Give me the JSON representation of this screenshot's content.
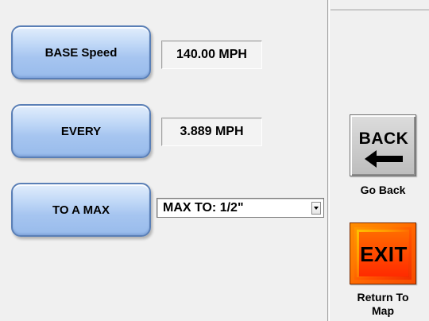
{
  "controls": {
    "base_speed": {
      "label": "BASE Speed",
      "value": "140.00 MPH"
    },
    "every": {
      "label": "EVERY",
      "value": "3.889 MPH"
    },
    "to_a_max": {
      "label": "TO A MAX",
      "selected": "MAX TO: 1/2\""
    }
  },
  "nav": {
    "back": {
      "icon_text": "BACK",
      "icon": "left-arrow-icon",
      "caption": "Go Back"
    },
    "exit": {
      "icon_text": "EXIT",
      "caption_line1": "Return To",
      "caption_line2": "Map",
      "color": "#ff3c00"
    }
  },
  "colors": {
    "button_blue": "#a6c5f0",
    "background": "#f0f0f0"
  }
}
